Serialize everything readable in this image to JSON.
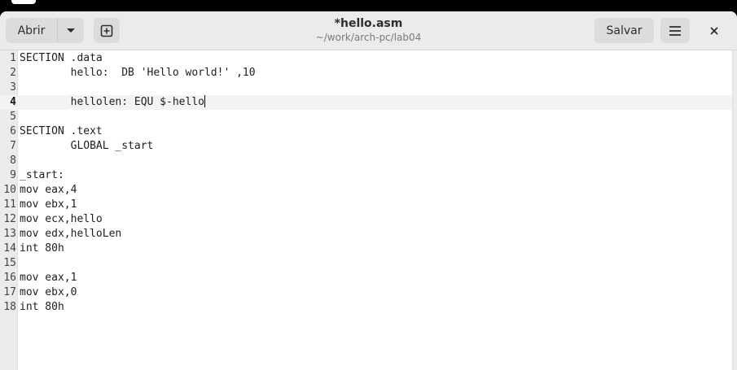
{
  "header": {
    "open_label": "Abrir",
    "title": "*hello.asm",
    "subtitle": "~/work/arch-pc/lab04",
    "save_label": "Salvar",
    "icons": {
      "open_dropdown": "chevron-down-icon",
      "new_document": "new-tab-icon",
      "menu": "hamburger-menu-icon",
      "close": "close-icon"
    }
  },
  "editor": {
    "current_line": 4,
    "lines": [
      {
        "num": "1",
        "text": "SECTION .data"
      },
      {
        "num": "2",
        "text": "        hello:  DB 'Hello world!' ,10"
      },
      {
        "num": "3",
        "text": ""
      },
      {
        "num": "4",
        "text": "        hellolen: EQU $-hello"
      },
      {
        "num": "5",
        "text": ""
      },
      {
        "num": "6",
        "text": "SECTION .text"
      },
      {
        "num": "7",
        "text": "        GLOBAL _start"
      },
      {
        "num": "8",
        "text": ""
      },
      {
        "num": "9",
        "text": "_start:"
      },
      {
        "num": "10",
        "text": "mov eax,4"
      },
      {
        "num": "11",
        "text": "mov ebx,1"
      },
      {
        "num": "12",
        "text": "mov ecx,hello"
      },
      {
        "num": "13",
        "text": "mov edx,helloLen"
      },
      {
        "num": "14",
        "text": "int 80h"
      },
      {
        "num": "15",
        "text": ""
      },
      {
        "num": "16",
        "text": "mov eax,1"
      },
      {
        "num": "17",
        "text": "mov ebx,0"
      },
      {
        "num": "18",
        "text": "int 80h"
      }
    ]
  },
  "colors": {
    "headerbar": "#ebebeb",
    "button": "#dcdcdc",
    "gutter": "#ebebeb",
    "current_line": "#f3f3f3"
  }
}
